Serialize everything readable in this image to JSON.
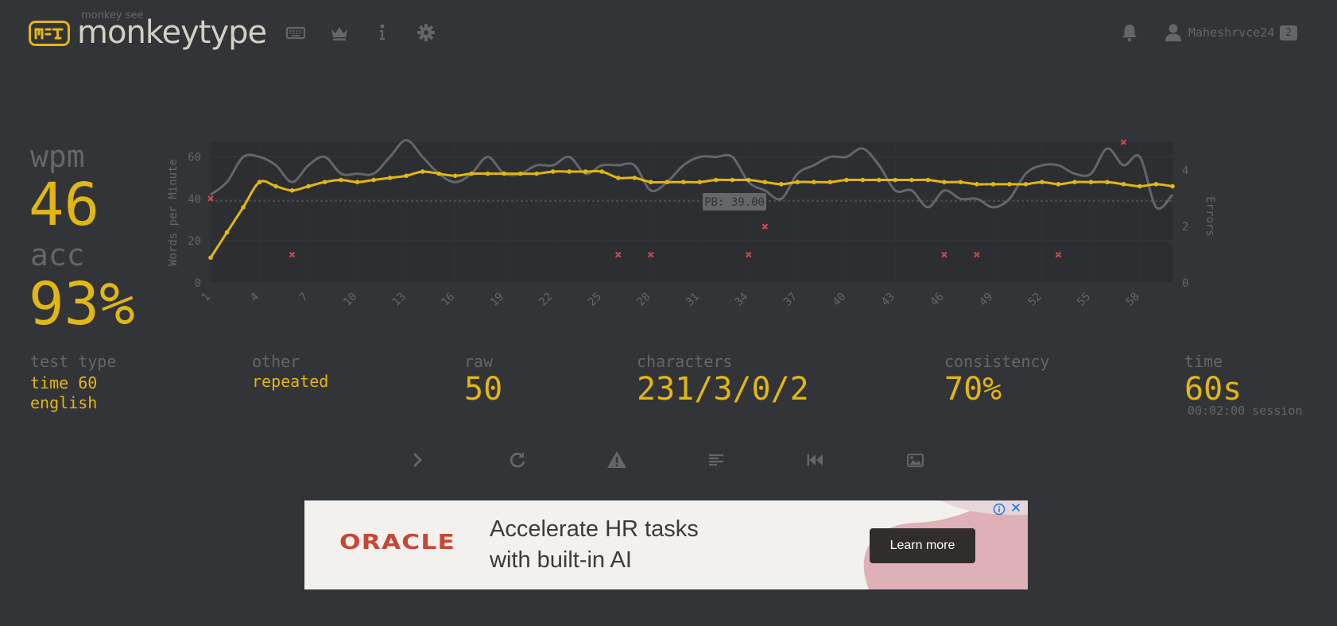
{
  "header": {
    "logo_top": "monkey see",
    "logo_text": "monkeytype",
    "nav": [
      "keyboard-icon",
      "crown-icon",
      "info-icon",
      "gear-icon"
    ],
    "username": "Maheshrvce24",
    "level": "2"
  },
  "result": {
    "wpm_label": "wpm",
    "wpm": "46",
    "acc_label": "acc",
    "acc": "93%",
    "test_type_label": "test type",
    "test_type_line1": "time 60",
    "test_type_line2": "english",
    "other_label": "other",
    "other_value": "repeated",
    "raw_label": "raw",
    "raw": "50",
    "characters_label": "characters",
    "characters": "231/3/0/2",
    "consistency_label": "consistency",
    "consistency": "70%",
    "time_label": "time",
    "time": "60s",
    "session": "00:02:00 session"
  },
  "actions": [
    "next-test",
    "restart",
    "report",
    "word-history",
    "replay",
    "screenshot"
  ],
  "colors": {
    "bg": "#323437",
    "main": "#e2b714",
    "sub": "#646669",
    "text": "#d1d0c5",
    "error": "#ca4754"
  },
  "ad": {
    "brand": "ORACLE",
    "line1": "Accelerate HR tasks",
    "line2": "with built-in AI",
    "cta": "Learn more",
    "close": "✕"
  },
  "chart_data": {
    "type": "line",
    "ylabel": "Words per Minute",
    "y2label": "Errors",
    "ylim": [
      0,
      67
    ],
    "y2lim": [
      0,
      5
    ],
    "yticks": [
      0,
      20,
      40,
      60
    ],
    "y2ticks": [
      0,
      2,
      4
    ],
    "xticks": [
      1,
      4,
      7,
      10,
      13,
      16,
      19,
      22,
      25,
      28,
      31,
      34,
      37,
      40,
      43,
      46,
      49,
      52,
      55,
      58
    ],
    "pb": 39,
    "pb_label": "PB: 39.00",
    "x": [
      1,
      2,
      3,
      4,
      5,
      6,
      7,
      8,
      9,
      10,
      11,
      12,
      13,
      14,
      15,
      16,
      17,
      18,
      19,
      20,
      21,
      22,
      23,
      24,
      25,
      26,
      27,
      28,
      29,
      30,
      31,
      32,
      33,
      34,
      35,
      36,
      37,
      38,
      39,
      40,
      41,
      42,
      43,
      44,
      45,
      46,
      47,
      48,
      49,
      50,
      51,
      52,
      53,
      54,
      55,
      56,
      57,
      58,
      59,
      60
    ],
    "series": [
      {
        "name": "wpm",
        "color": "#e2b714",
        "values": [
          12,
          24,
          36,
          48,
          46,
          44,
          46,
          48,
          49,
          48,
          49,
          50,
          51,
          53,
          52,
          51,
          52,
          52,
          52,
          52,
          52,
          53,
          53,
          53,
          53,
          50,
          50,
          48,
          48,
          48,
          48,
          49,
          49,
          49,
          48,
          47,
          48,
          48,
          48,
          49,
          49,
          49,
          49,
          49,
          49,
          48,
          48,
          47,
          47,
          47,
          47,
          48,
          47,
          48,
          48,
          48,
          47,
          46,
          47,
          46
        ]
      },
      {
        "name": "raw",
        "color": "#646669",
        "values": [
          42,
          48,
          60,
          60,
          56,
          48,
          56,
          60,
          52,
          52,
          52,
          60,
          68,
          60,
          52,
          48,
          52,
          60,
          52,
          52,
          56,
          56,
          60,
          52,
          56,
          56,
          56,
          44,
          48,
          56,
          60,
          60,
          60,
          48,
          44,
          40,
          52,
          56,
          60,
          60,
          64,
          56,
          44,
          44,
          36,
          44,
          40,
          40,
          36,
          40,
          52,
          56,
          56,
          52,
          52,
          64,
          56,
          60,
          36,
          42
        ]
      }
    ],
    "errors": [
      {
        "x": 1,
        "y": 3
      },
      {
        "x": 6,
        "y": 1
      },
      {
        "x": 26,
        "y": 1
      },
      {
        "x": 28,
        "y": 1
      },
      {
        "x": 34,
        "y": 1
      },
      {
        "x": 35,
        "y": 2
      },
      {
        "x": 46,
        "y": 1
      },
      {
        "x": 48,
        "y": 1
      },
      {
        "x": 53,
        "y": 1
      },
      {
        "x": 57,
        "y": 5
      }
    ]
  }
}
